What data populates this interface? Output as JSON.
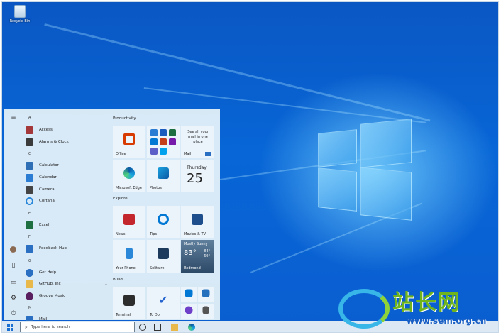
{
  "desktop": {
    "recycle_bin_label": "Recycle Bin"
  },
  "start_menu": {
    "letters": [
      "A",
      "C",
      "E",
      "F",
      "G",
      "M"
    ],
    "apps": [
      {
        "label": "Access",
        "icon": "access-icon",
        "color": "#a4373a"
      },
      {
        "label": "Alarms & Clock",
        "icon": "alarm-clock-icon",
        "color": "#3b3b3b"
      },
      {
        "label": "Calculator",
        "icon": "calculator-icon",
        "color": "#2f6fb5"
      },
      {
        "label": "Calendar",
        "icon": "calendar-icon",
        "color": "#2b7cd3"
      },
      {
        "label": "Camera",
        "icon": "camera-icon",
        "color": "#444444"
      },
      {
        "label": "Cortana",
        "icon": "cortana-icon",
        "color": "#2b88d8"
      },
      {
        "label": "Excel",
        "icon": "excel-icon",
        "color": "#1d6f42"
      },
      {
        "label": "Feedback Hub",
        "icon": "feedback-hub-icon",
        "color": "#2b6fc2"
      },
      {
        "label": "Get Help",
        "icon": "get-help-icon",
        "color": "#2b6fc2"
      },
      {
        "label": "GitHub, Inc",
        "icon": "folder-icon",
        "color": "#e8b84a"
      },
      {
        "label": "Groove Music",
        "icon": "groove-music-icon",
        "color": "#5a1f5e"
      },
      {
        "label": "Mail",
        "icon": "mail-icon",
        "color": "#2b6fc2"
      }
    ],
    "groups": [
      "Productivity",
      "Explore",
      "Build"
    ],
    "tiles": {
      "office": "Office",
      "mail": "Mail",
      "mail_promo": "See all your mail in one place",
      "edge": "Microsoft Edge",
      "photos": "Photos",
      "calendar_day": "Thursday",
      "calendar_date": "25",
      "news": "News",
      "tips": "Tips",
      "movies": "Movies & TV",
      "phone": "Your Phone",
      "solitaire": "Solitaire",
      "weather_cond": "Mostly Sunny",
      "weather_temp": "83°",
      "weather_hi": "84°",
      "weather_lo": "60°",
      "weather_city": "Redmond",
      "terminal": "Terminal",
      "todo": "To Do"
    }
  },
  "taskbar": {
    "search_placeholder": "Type here to search"
  },
  "watermark": {
    "chars": "站长网",
    "url": "www.sem.org.cn"
  },
  "colors": {
    "desktop_blue": "#0866d6",
    "start_bg": "#e1eef8",
    "taskbar_bg": "#dce8f3"
  }
}
